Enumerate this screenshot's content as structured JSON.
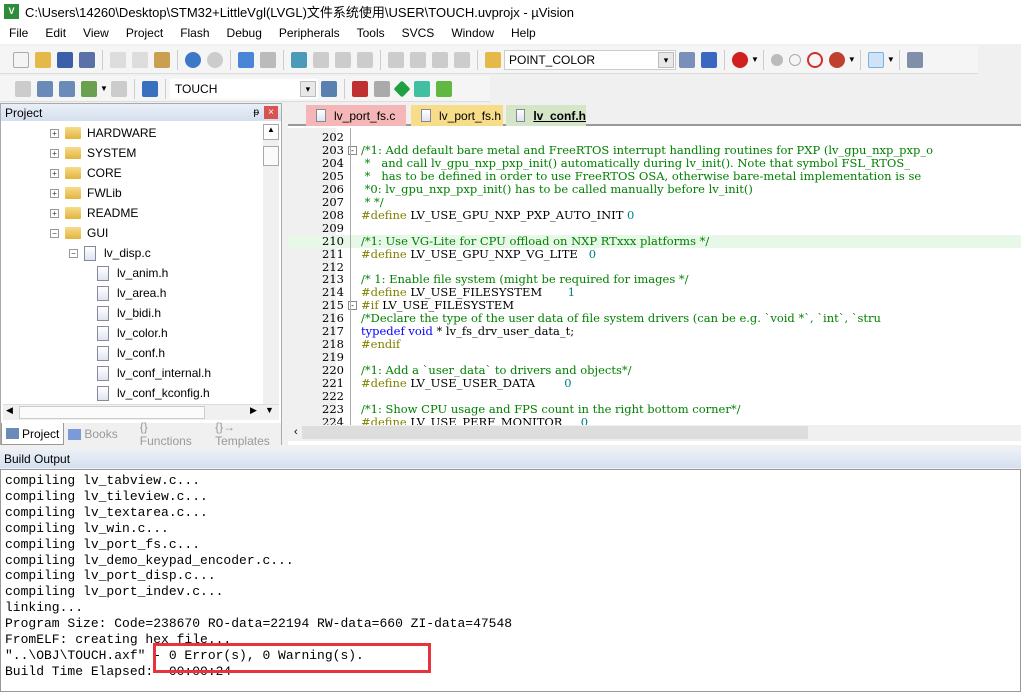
{
  "window": {
    "title": "C:\\Users\\14260\\Desktop\\STM32+LittleVgl(LVGL)文件系统使用\\USER\\TOUCH.uvprojx - µVision",
    "icon": "uvision-logo"
  },
  "menu": [
    "File",
    "Edit",
    "View",
    "Project",
    "Flash",
    "Debug",
    "Peripherals",
    "Tools",
    "SVCS",
    "Window",
    "Help"
  ],
  "toolbar1": {
    "find_combo": "POINT_COLOR"
  },
  "toolbar2": {
    "target_combo": "TOUCH"
  },
  "project": {
    "title": "Project",
    "tree": [
      {
        "label": "HARDWARE",
        "type": "folder",
        "level": 0,
        "expanded": false
      },
      {
        "label": "SYSTEM",
        "type": "folder",
        "level": 0,
        "expanded": false
      },
      {
        "label": "CORE",
        "type": "folder",
        "level": 0,
        "expanded": false
      },
      {
        "label": "FWLib",
        "type": "folder",
        "level": 0,
        "expanded": false
      },
      {
        "label": "README",
        "type": "folder",
        "level": 0,
        "expanded": false
      },
      {
        "label": "GUI",
        "type": "folder",
        "level": 0,
        "expanded": true
      },
      {
        "label": "lv_disp.c",
        "type": "file",
        "level": 1,
        "expanded": true
      },
      {
        "label": "lv_anim.h",
        "type": "header",
        "level": 2
      },
      {
        "label": "lv_area.h",
        "type": "header",
        "level": 2
      },
      {
        "label": "lv_bidi.h",
        "type": "header",
        "level": 2
      },
      {
        "label": "lv_color.h",
        "type": "header",
        "level": 2
      },
      {
        "label": "lv_conf.h",
        "type": "header",
        "level": 2
      },
      {
        "label": "lv_conf_internal.h",
        "type": "header",
        "level": 2
      },
      {
        "label": "lv_conf_kconfig.h",
        "type": "header",
        "level": 2
      }
    ],
    "tabs": [
      {
        "label": "Project",
        "active": true
      },
      {
        "label": "Books"
      },
      {
        "label": "{} Functions"
      },
      {
        "label": "{}→ Templates"
      }
    ]
  },
  "editor": {
    "tabs": [
      {
        "label": "lv_port_fs.c",
        "color": "#f4b6b6"
      },
      {
        "label": "lv_port_fs.h",
        "color": "#f7dc8a"
      },
      {
        "label": "lv_conf.h",
        "color": "#d5e6c8",
        "active": true
      }
    ],
    "lines": [
      {
        "n": "202",
        "t": []
      },
      {
        "n": "203",
        "fold": "-",
        "t": [
          [
            "cmt",
            "/*1: Add default bare metal and FreeRTOS interrupt handling routines for PXP (lv_gpu_nxp_pxp_o"
          ]
        ]
      },
      {
        "n": "204",
        "t": [
          [
            "cmt",
            " *   and call lv_gpu_nxp_pxp_init() automatically during lv_init(). Note that symbol FSL_RTOS_"
          ]
        ]
      },
      {
        "n": "205",
        "t": [
          [
            "cmt",
            " *   has to be defined in order to use FreeRTOS OSA, otherwise bare-metal implementation is se"
          ]
        ]
      },
      {
        "n": "206",
        "t": [
          [
            "cmt",
            " *0: lv_gpu_nxp_pxp_init() has to be called manually before lv_init()"
          ]
        ]
      },
      {
        "n": "207",
        "t": [
          [
            "cmt",
            " * */"
          ]
        ]
      },
      {
        "n": "208",
        "t": [
          [
            "pre",
            "#define"
          ],
          [
            "id",
            " LV_USE_GPU_NXP_PXP_AUTO_INIT "
          ],
          [
            "num",
            "0"
          ]
        ]
      },
      {
        "n": "209",
        "t": []
      },
      {
        "n": "210",
        "hl": true,
        "t": [
          [
            "cmt",
            "/*1: Use VG-Lite for CPU offload on NXP RTxxx platforms */"
          ]
        ]
      },
      {
        "n": "211",
        "t": [
          [
            "pre",
            "#define"
          ],
          [
            "id",
            " LV_USE_GPU_NXP_VG_LITE   "
          ],
          [
            "num",
            "0"
          ]
        ]
      },
      {
        "n": "212",
        "t": []
      },
      {
        "n": "213",
        "t": [
          [
            "cmt",
            "/* 1: Enable file system (might be required for images */"
          ]
        ]
      },
      {
        "n": "214",
        "t": [
          [
            "pre",
            "#define"
          ],
          [
            "id",
            " LV_USE_FILESYSTEM       "
          ],
          [
            "num",
            "1"
          ]
        ]
      },
      {
        "n": "215",
        "fold": "-",
        "t": [
          [
            "pre",
            "#if"
          ],
          [
            "id",
            " LV_USE_FILESYSTEM"
          ]
        ]
      },
      {
        "n": "216",
        "t": [
          [
            "cmt",
            "/*Declare the type of the user data of file system drivers (can be e.g. `void *`, `int`, `stru"
          ]
        ]
      },
      {
        "n": "217",
        "t": [
          [
            "kw",
            "typedef"
          ],
          [
            "id",
            " "
          ],
          [
            "kw",
            "void"
          ],
          [
            "id",
            " * lv_fs_drv_user_data_t;"
          ]
        ]
      },
      {
        "n": "218",
        "t": [
          [
            "pre",
            "#endif"
          ]
        ]
      },
      {
        "n": "219",
        "t": []
      },
      {
        "n": "220",
        "t": [
          [
            "cmt",
            "/*1: Add a `user_data` to drivers and objects*/"
          ]
        ]
      },
      {
        "n": "221",
        "t": [
          [
            "pre",
            "#define"
          ],
          [
            "id",
            " LV_USE_USER_DATA        "
          ],
          [
            "num",
            "0"
          ]
        ]
      },
      {
        "n": "222",
        "t": []
      },
      {
        "n": "223",
        "t": [
          [
            "cmt",
            "/*1: Show CPU usage and FPS count in the right bottom corner*/"
          ]
        ]
      },
      {
        "n": "224",
        "t": [
          [
            "pre",
            "#define"
          ],
          [
            "id",
            " LV_USE_PERF_MONITOR     "
          ],
          [
            "num",
            "0"
          ]
        ]
      }
    ]
  },
  "build_output": {
    "title": "Build Output",
    "lines": [
      "compiling lv_tabview.c...",
      "compiling lv_tileview.c...",
      "compiling lv_textarea.c...",
      "compiling lv_win.c...",
      "compiling lv_port_fs.c...",
      "compiling lv_demo_keypad_encoder.c...",
      "compiling lv_port_disp.c...",
      "compiling lv_port_indev.c...",
      "linking...",
      "Program Size: Code=238670 RO-data=22194 RW-data=660 ZI-data=47548",
      "FromELF: creating hex file...",
      "\"..\\OBJ\\TOUCH.axf\" - 0 Error(s), 0 Warning(s).",
      "Build Time Elapsed:  00:00:24"
    ],
    "highlight_color": "#e8323c"
  },
  "colors": {
    "comment": "#008000",
    "preprocessor": "#808000",
    "keyword": "#0000ff",
    "number": "#008080"
  }
}
